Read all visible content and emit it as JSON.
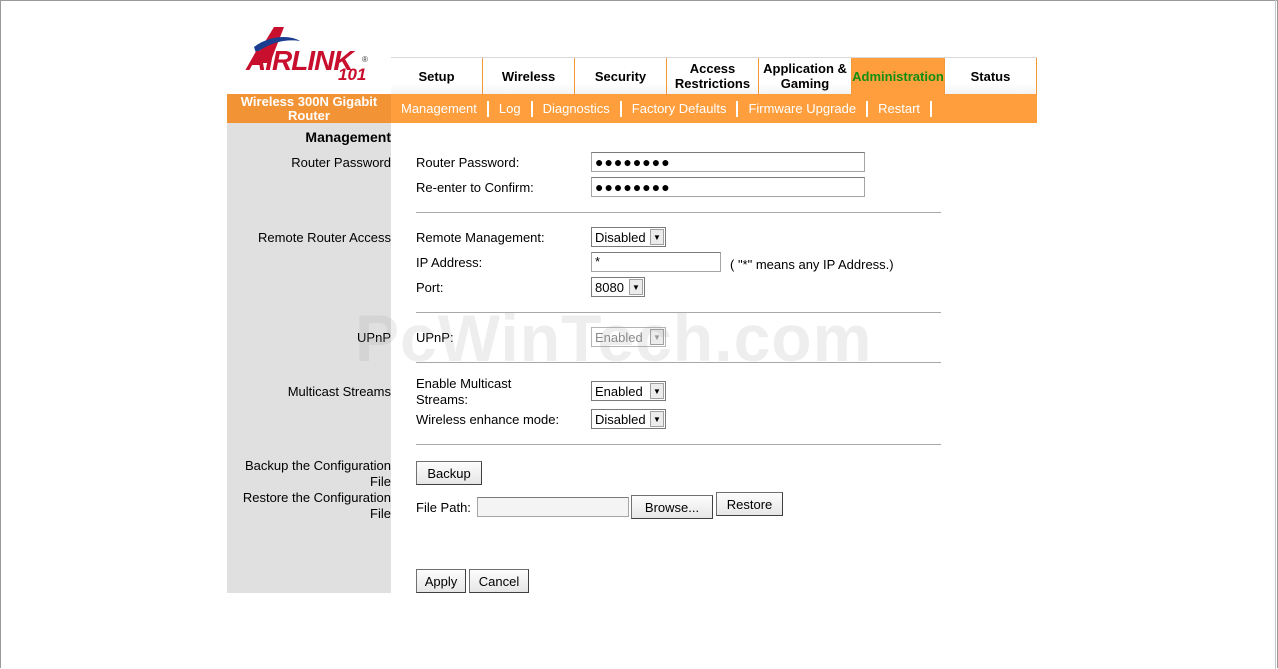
{
  "brand": {
    "logo_main": "AIRLINK",
    "logo_sub": "101",
    "product": "Wireless 300N Gigabit Router"
  },
  "topnav": [
    {
      "label": "Setup"
    },
    {
      "label": "Wireless"
    },
    {
      "label": "Security"
    },
    {
      "label": "Access Restrictions"
    },
    {
      "label": "Application & Gaming"
    },
    {
      "label": "Administration",
      "active": true
    },
    {
      "label": "Status"
    }
  ],
  "subnav": [
    "Management",
    "Log",
    "Diagnostics",
    "Factory Defaults",
    "Firmware Upgrade",
    "Restart"
  ],
  "section_title": "Management",
  "sections": {
    "router_password": "Router Password",
    "remote_access": "Remote Router Access",
    "upnp": "UPnP",
    "multicast": "Multicast Streams",
    "backup": "Backup the Configuration File",
    "restore": "Restore the Configuration File"
  },
  "fields": {
    "router_password_label": "Router Password:",
    "router_password_value": "●●●●●●●●",
    "confirm_label": "Re-enter to Confirm:",
    "confirm_value": "●●●●●●●●",
    "remote_mgmt_label": "Remote Management:",
    "remote_mgmt_value": "Disabled",
    "ip_label": "IP Address:",
    "ip_value": "*",
    "ip_hint": "( \"*\" means any IP Address.)",
    "port_label": "Port:",
    "port_value": "8080",
    "upnp_label": "UPnP:",
    "upnp_value": "Enabled",
    "multicast_label": "Enable Multicast Streams:",
    "multicast_value": "Enabled",
    "wireless_enhance_label": "Wireless enhance mode:",
    "wireless_enhance_value": "Disabled",
    "file_path_label": "File Path:",
    "file_path_value": ""
  },
  "buttons": {
    "backup": "Backup",
    "browse": "Browse...",
    "restore": "Restore",
    "apply": "Apply",
    "cancel": "Cancel"
  },
  "watermark": "PcWinTech.com",
  "colors": {
    "accent": "#ff9e3d",
    "active_tab_text": "#118f11",
    "sidebar": "#e0e0e0"
  }
}
